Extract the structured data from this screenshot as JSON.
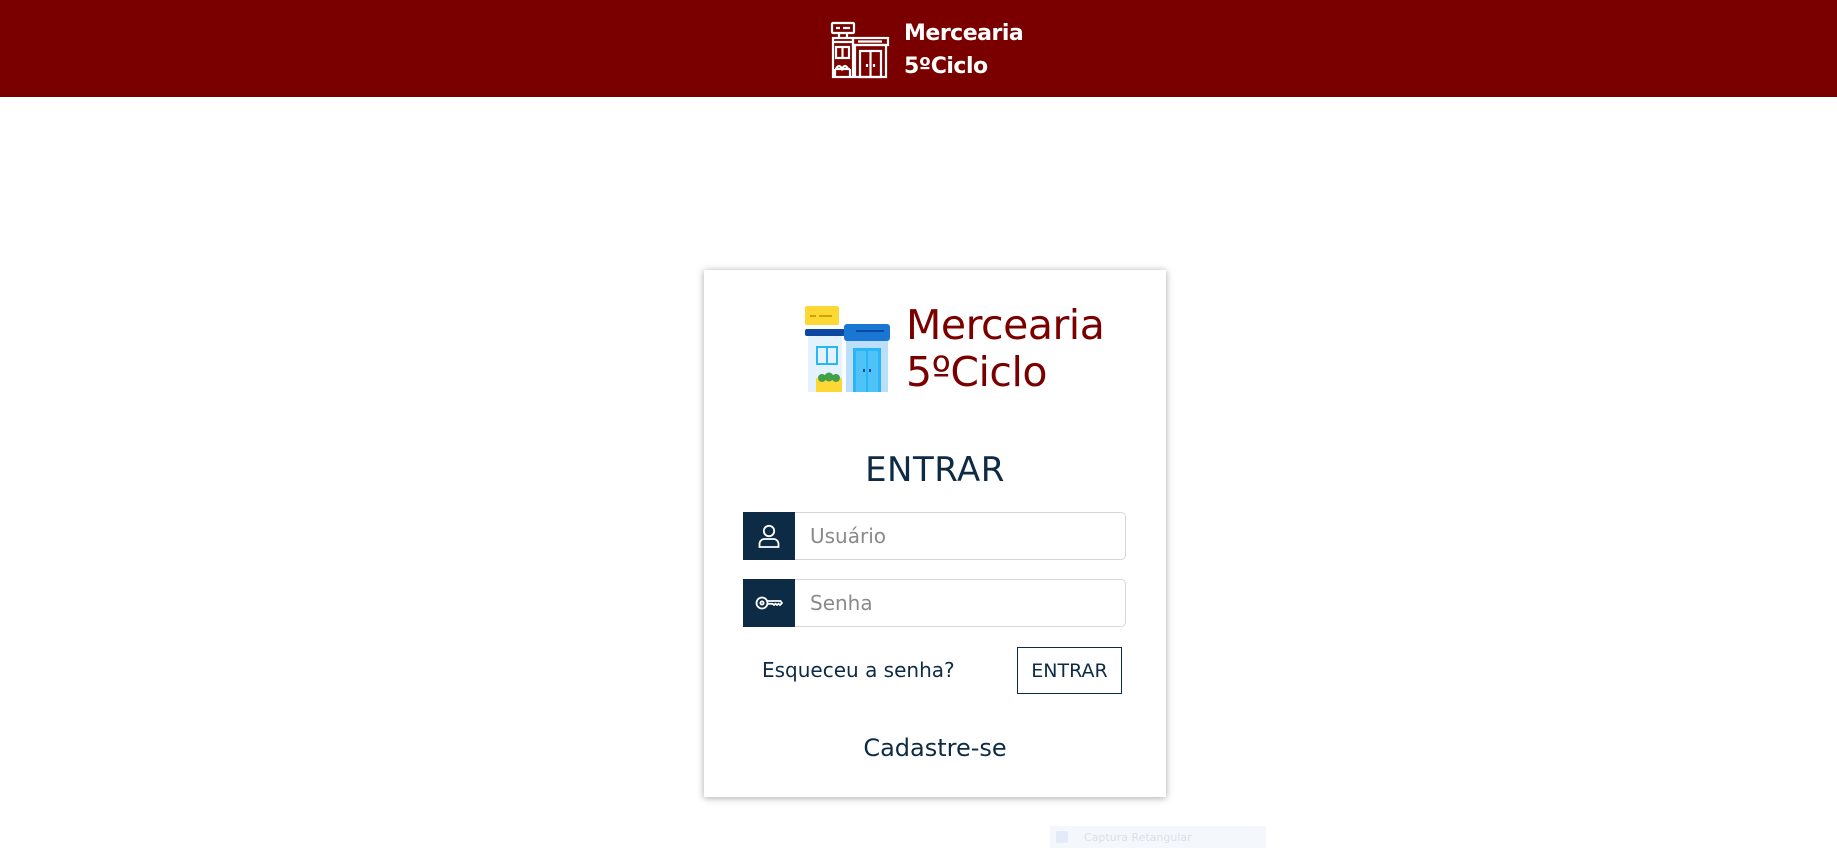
{
  "header": {
    "brand_line1": "Mercearia",
    "brand_line2": "5ºCiclo",
    "logo_icon": "store-building-icon",
    "background_color": "#7a0000"
  },
  "login_card": {
    "brand_line1": "Mercearia",
    "brand_line2": "5ºCiclo",
    "logo_icon": "store-building-color-icon",
    "brand_color": "#7a0000",
    "title": "ENTRAR",
    "username_field": {
      "placeholder": "Usuário",
      "value": "",
      "icon": "user-icon"
    },
    "password_field": {
      "placeholder": "Senha",
      "value": "",
      "icon": "key-icon"
    },
    "forgot_password_label": "Esqueceu a senha?",
    "submit_label": "ENTRAR",
    "register_label": "Cadastre-se",
    "accent_color": "#0d2b45"
  },
  "screen_capture_overlay": {
    "label": "Captura Retangular"
  }
}
